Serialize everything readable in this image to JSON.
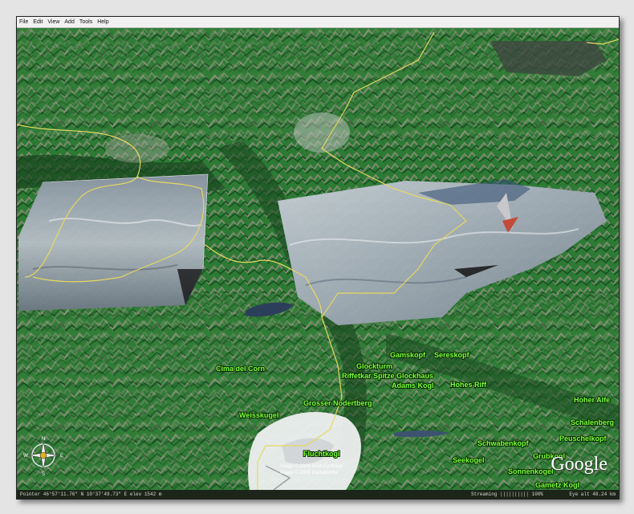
{
  "menu": {
    "items": [
      "File",
      "Edit",
      "View",
      "Add",
      "Tools",
      "Help"
    ]
  },
  "map": {
    "labels": [
      {
        "id": "glocknturm",
        "text": "Glockturm"
      },
      {
        "id": "gamskopf",
        "text": "Gamskopf"
      },
      {
        "id": "sereskopf",
        "text": "Sereskopf"
      },
      {
        "id": "riffetkar",
        "text": "Riffetkar Spitze Glockhaus"
      },
      {
        "id": "adams",
        "text": "Adams Kogl"
      },
      {
        "id": "hohes",
        "text": "Hohes Riff"
      },
      {
        "id": "cima",
        "text": "Cima del Corn"
      },
      {
        "id": "grosser",
        "text": "Grosser Nodertberg"
      },
      {
        "id": "weisskugel",
        "text": "Weisskugel"
      },
      {
        "id": "fluchtkogl",
        "text": "Fluchtkogl"
      },
      {
        "id": "schwabenkopf",
        "text": "Schwabenkopf"
      },
      {
        "id": "seekogel",
        "text": "Seekogel"
      },
      {
        "id": "grubkogl",
        "text": "Grubkogl"
      },
      {
        "id": "sonnenkogel",
        "text": "Sonnenkogel"
      },
      {
        "id": "gamezkogl",
        "text": "Gametz Kogl"
      },
      {
        "id": "hoheralfe",
        "text": "Hoher Alfe"
      },
      {
        "id": "schalen",
        "text": "Schalenberg"
      },
      {
        "id": "peuschel",
        "text": "Peuschelkopf"
      }
    ],
    "copyright_1": "Image © 2006 MDA EarthSat",
    "copyright_2": "Image © 2006 DigitalGlobe",
    "logo": "Google",
    "compass": {
      "n": "N",
      "s": "S",
      "e": "E",
      "w": "W"
    }
  },
  "status": {
    "pointer": "Pointer  46°57'11.76\" N   10°37'49.73\" E   elev 1542 m",
    "streaming": "Streaming |||||||||| 100%",
    "eye_alt": "Eye alt  48.24 km"
  },
  "colors": {
    "forest": "#1f6b2a",
    "valley": "#3f8a3a",
    "rock": "#8b8a7c",
    "snow": "#f0f2f2",
    "lake": "#2c3f5a",
    "border_line": "#e6d860",
    "label_green": "#7dff3a"
  }
}
